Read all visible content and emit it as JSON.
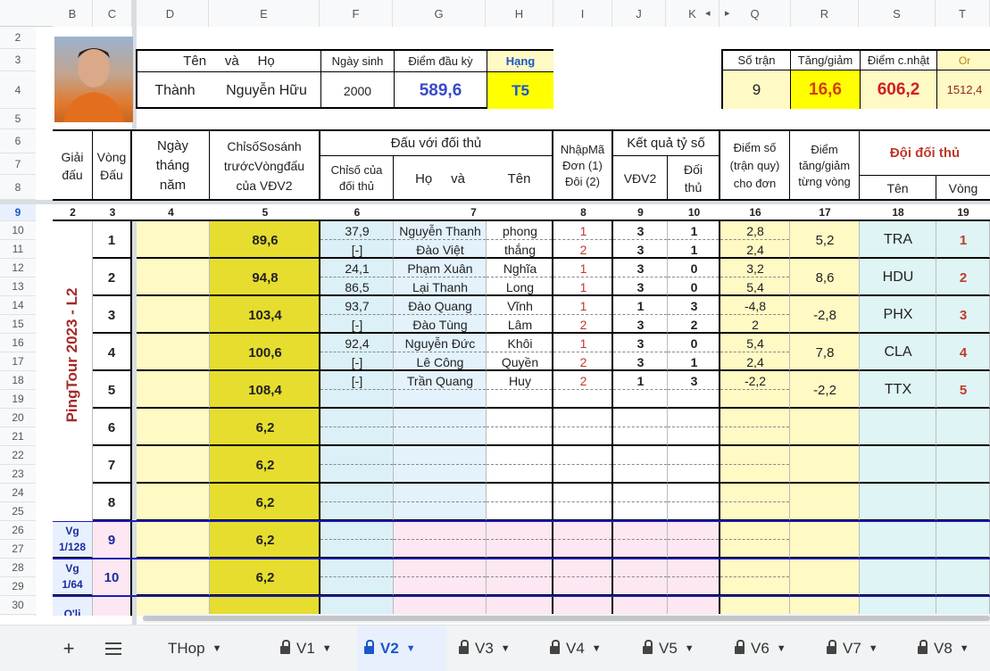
{
  "column_headers": [
    "B",
    "C",
    "D",
    "E",
    "F",
    "G",
    "H",
    "I",
    "J",
    "K",
    "Q",
    "R",
    "S",
    "T"
  ],
  "row_headers": [
    "2",
    "3",
    "4",
    "5",
    "6",
    "7",
    "8",
    "9",
    "10",
    "11",
    "12",
    "13",
    "14",
    "15",
    "16",
    "17",
    "18",
    "19",
    "20",
    "21",
    "22",
    "23",
    "24",
    "25",
    "26",
    "27",
    "28",
    "29",
    "30"
  ],
  "profile": {
    "name_label": "Tên     và     Họ",
    "birth_label": "Ngày sinh",
    "start_points_label": "Điểm đầu kỳ",
    "rank_label": "Hạng",
    "first_name": "Thành",
    "last_name": "Nguyễn Hữu",
    "birth_year": "2000",
    "start_points": "589,6",
    "rank": "T5"
  },
  "summary": {
    "matches_label": "Số trận",
    "change_label": "Tăng/giảm",
    "updated_label": "Điểm c.nhật",
    "or_label": "Or",
    "matches": "9",
    "change": "16,6",
    "updated": "606,2",
    "or_value": "1512,4"
  },
  "table_header": {
    "tournament": "Giải đấu",
    "round": "Vòng Đấu",
    "date": "Ngày tháng năm",
    "compare_index": "ChỉsốSosánh trướcVòngđấu của VĐV2",
    "vs_opponent": "Đấu với đối thủ",
    "opp_index": "Chỉsố của đối thủ",
    "opp_last": "Họ     và",
    "opp_first": "Tên",
    "entry_code": "NhậpMã Đơn (1) Đôi (2)",
    "result": "Kết quả tỷ số",
    "vdv2": "VĐV2",
    "opponent_score": "Đối thủ",
    "points": "Điểm số (trận quy) cho đơn",
    "round_change": "Điểm tăng/giảm từng vòng",
    "opp_team": "Đội đối thủ",
    "team_name": "Tên",
    "team_round": "Vòng"
  },
  "index_row": [
    "2",
    "3",
    "4",
    "5",
    "6",
    "7",
    "8",
    "9",
    "10",
    "16",
    "17",
    "18",
    "19"
  ],
  "tournament_label": "PingTour 2023 - L2",
  "rounds": [
    {
      "round": "1",
      "compare": "89,6",
      "change": "5,2",
      "team": "TRA",
      "team_round": "1"
    },
    {
      "round": "2",
      "compare": "94,8",
      "change": "8,6",
      "team": "HDU",
      "team_round": "2"
    },
    {
      "round": "3",
      "compare": "103,4",
      "change": "-2,8",
      "team": "PHX",
      "team_round": "3"
    },
    {
      "round": "4",
      "compare": "100,6",
      "change": "7,8",
      "team": "CLA",
      "team_round": "4"
    },
    {
      "round": "5",
      "compare": "108,4",
      "change": "-2,2",
      "team": "TTX",
      "team_round": "5"
    },
    {
      "round": "6",
      "compare": "6,2",
      "change": "",
      "team": "",
      "team_round": ""
    },
    {
      "round": "7",
      "compare": "6,2",
      "change": "",
      "team": "",
      "team_round": ""
    },
    {
      "round": "8",
      "compare": "6,2",
      "change": "",
      "team": "",
      "team_round": ""
    },
    {
      "round": "9",
      "compare": "6,2",
      "change": "",
      "team": "",
      "team_round": "",
      "label": "Vg 1/128"
    },
    {
      "round": "10",
      "compare": "6,2",
      "change": "",
      "team": "",
      "team_round": "",
      "label": "Vg 1/64"
    },
    {
      "round": "",
      "compare": "",
      "change": "",
      "team": "",
      "team_round": "",
      "label": "Q'li"
    }
  ],
  "matches": [
    {
      "opp_index": "37,9",
      "last": "Nguyễn Thanh",
      "first": "phong",
      "code": "1",
      "vdv2": "3",
      "opp": "1",
      "points": "2,8"
    },
    {
      "opp_index": "[-]",
      "last": "Đào Việt",
      "first": "thắng",
      "code": "2",
      "vdv2": "3",
      "opp": "1",
      "points": "2,4"
    },
    {
      "opp_index": "24,1",
      "last": "Phạm Xuân",
      "first": "Nghĩa",
      "code": "1",
      "vdv2": "3",
      "opp": "0",
      "points": "3,2"
    },
    {
      "opp_index": "86,5",
      "last": "Lại Thanh",
      "first": "Long",
      "code": "1",
      "vdv2": "3",
      "opp": "0",
      "points": "5,4"
    },
    {
      "opp_index": "93,7",
      "last": "Đào Quang",
      "first": "Vĩnh",
      "code": "1",
      "vdv2": "1",
      "opp": "3",
      "points": "-4,8"
    },
    {
      "opp_index": "[-]",
      "last": "Đào  Tùng",
      "first": "Lâm",
      "code": "2",
      "vdv2": "3",
      "opp": "2",
      "points": "2"
    },
    {
      "opp_index": "92,4",
      "last": "Nguyễn Đức",
      "first": "Khôi",
      "code": "1",
      "vdv2": "3",
      "opp": "0",
      "points": "5,4"
    },
    {
      "opp_index": "[-]",
      "last": "Lê Công",
      "first": "Quyền",
      "code": "2",
      "vdv2": "3",
      "opp": "1",
      "points": "2,4"
    },
    {
      "opp_index": "[-]",
      "last": "Trần Quang",
      "first": "Huy",
      "code": "2",
      "vdv2": "1",
      "opp": "3",
      "points": "-2,2"
    }
  ],
  "tabs": {
    "add_label": "+",
    "items": [
      {
        "label": "THop",
        "locked": false,
        "active": false
      },
      {
        "label": "V1",
        "locked": true,
        "active": false
      },
      {
        "label": "V2",
        "locked": true,
        "active": true
      },
      {
        "label": "V3",
        "locked": true,
        "active": false
      },
      {
        "label": "V4",
        "locked": true,
        "active": false
      },
      {
        "label": "V5",
        "locked": true,
        "active": false
      },
      {
        "label": "V6",
        "locked": true,
        "active": false
      },
      {
        "label": "V7",
        "locked": true,
        "active": false
      },
      {
        "label": "V8",
        "locked": true,
        "active": false
      }
    ]
  },
  "colors": {
    "yellow": "#fff9c4",
    "dark_yellow": "#e9e03f",
    "light_blue": "#dcf0f7",
    "active_tab": "#1a57c9",
    "red": "#c0392b"
  }
}
